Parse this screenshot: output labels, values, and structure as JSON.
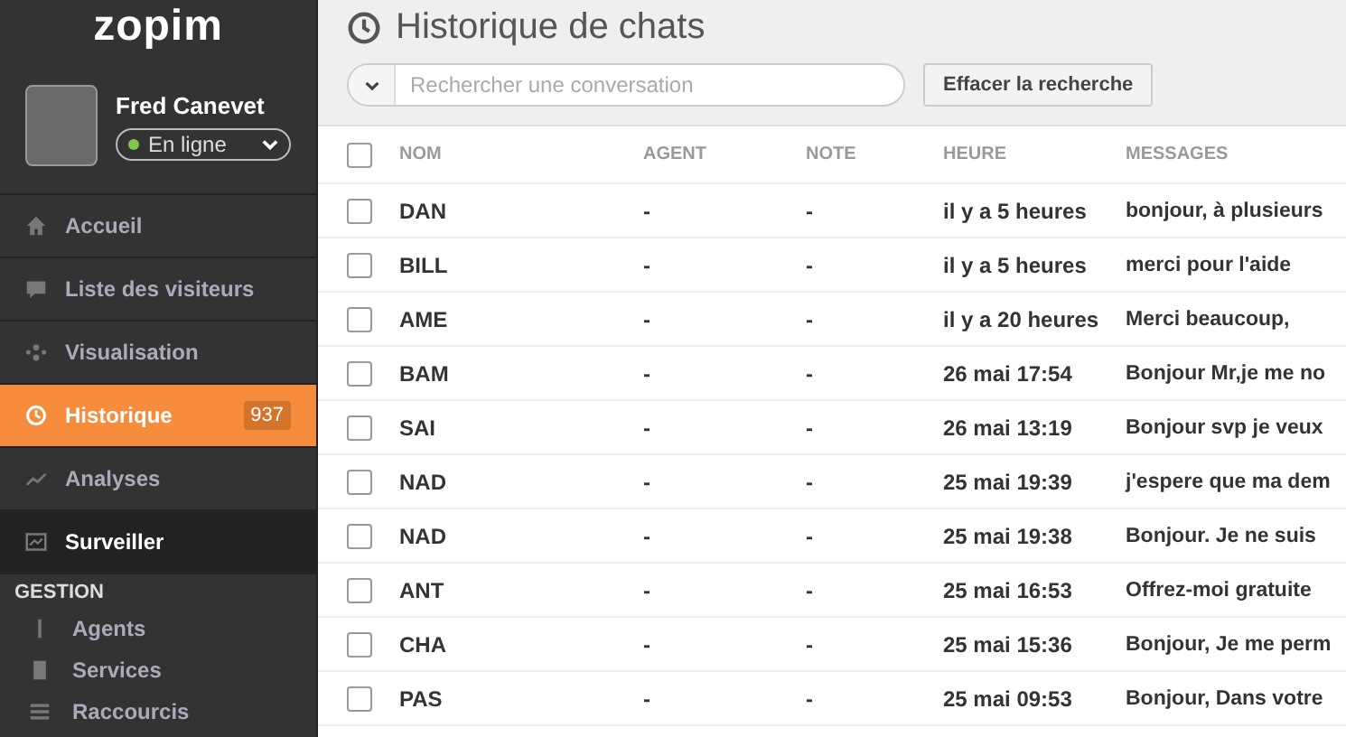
{
  "sidebar": {
    "logo": "zopim",
    "user": {
      "name": "Fred Canevet",
      "status": "En ligne",
      "online": true
    },
    "items": [
      {
        "label": "Accueil",
        "selected": false,
        "hovered": false
      },
      {
        "label": "Liste des visiteurs",
        "selected": false,
        "hovered": false
      },
      {
        "label": "Visualisation",
        "selected": false,
        "hovered": false
      },
      {
        "label": "Historique",
        "selected": true,
        "hovered": false,
        "badge": "937"
      },
      {
        "label": "Analyses",
        "selected": false,
        "hovered": false
      },
      {
        "label": "Surveiller",
        "selected": false,
        "hovered": true
      }
    ],
    "section": "GESTION",
    "sub_items": [
      {
        "label": "Agents"
      },
      {
        "label": "Services"
      },
      {
        "label": "Raccourcis"
      }
    ]
  },
  "page": {
    "title": "Historique de chats",
    "search": {
      "placeholder": "Rechercher une conversation"
    },
    "clear_button": "Effacer la recherche"
  },
  "table": {
    "select_all_checked": false,
    "columns": [
      "NOM",
      "AGENT",
      "NOTE",
      "HEURE",
      "MESSAGES"
    ],
    "rows": [
      {
        "name": "DAN",
        "agent": "-",
        "note": "-",
        "time": "il y a 5 heures",
        "message": "bonjour, à plusieurs",
        "checked": false
      },
      {
        "name": "BILL",
        "agent": "-",
        "note": "-",
        "time": "il y a 5 heures",
        "message": "merci pour l'aide",
        "checked": false
      },
      {
        "name": "AME",
        "agent": "-",
        "note": "-",
        "time": "il y a 20 heures",
        "message": "Merci beaucoup,",
        "checked": false
      },
      {
        "name": "BAM",
        "agent": "-",
        "note": "-",
        "time": "26 mai 17:54",
        "message": "Bonjour Mr,je me no",
        "checked": false
      },
      {
        "name": "SAI",
        "agent": "-",
        "note": "-",
        "time": "26 mai 13:19",
        "message": "Bonjour svp je veux",
        "checked": false
      },
      {
        "name": "NAD",
        "agent": "-",
        "note": "-",
        "time": "25 mai 19:39",
        "message": "j'espere que ma dem",
        "checked": false
      },
      {
        "name": "NAD",
        "agent": "-",
        "note": "-",
        "time": "25 mai 19:38",
        "message": "Bonjour. Je ne suis",
        "checked": false
      },
      {
        "name": "ANT",
        "agent": "-",
        "note": "-",
        "time": "25 mai 16:53",
        "message": "Offrez-moi gratuite",
        "checked": false
      },
      {
        "name": "CHA",
        "agent": "-",
        "note": "-",
        "time": "25 mai 15:36",
        "message": "Bonjour, Je me perm",
        "checked": false
      },
      {
        "name": "PAS",
        "agent": "-",
        "note": "-",
        "time": "25 mai 09:53",
        "message": "Bonjour, Dans votre",
        "checked": false
      }
    ]
  }
}
